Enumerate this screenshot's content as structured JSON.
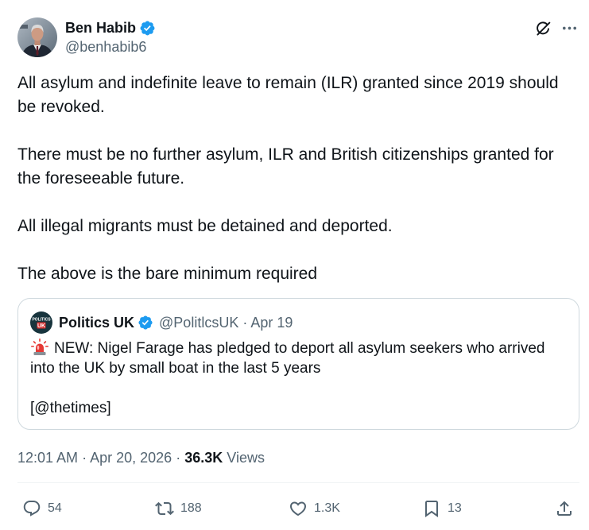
{
  "colors": {
    "text_primary": "#0f1419",
    "text_secondary": "#536471",
    "verified_blue": "#1d9bf0",
    "border": "#cfd9de",
    "background": "#ffffff"
  },
  "header_icons": [
    "grok-icon",
    "more-icon"
  ],
  "tweet": {
    "author": {
      "name": "Ben Habib",
      "handle": "@benhabib6",
      "verified": true
    },
    "paragraphs": [
      {
        "lines": [
          "All asylum and indefinite leave to remain (ILR) granted since 2019 should",
          "be revoked."
        ]
      },
      {
        "lines": [
          "There must be no further asylum, ILR and British citizenships granted for",
          "the foreseeable future."
        ]
      },
      {
        "lines": [
          "All illegal migrants must be detained and deported."
        ]
      },
      {
        "lines": [
          "The above is the bare minimum required"
        ]
      }
    ],
    "quote": {
      "author": {
        "name": "Politics UK",
        "handle": "@PolitlcsUK",
        "verified": true,
        "logo_text_top": "POLITICS",
        "logo_text_bottom": "UK"
      },
      "separator": "·",
      "date": "Apr 19",
      "lead_icon": "rotating-light-icon",
      "lines": [
        "NEW: Nigel Farage has pledged to deport all asylum seekers who arrived",
        "into the UK by small boat in the last 5 years"
      ],
      "source": "[@thetimes]"
    },
    "meta": {
      "time": "12:01 AM",
      "separator": "·",
      "date": "Apr 20, 2026",
      "views_count": "36.3K",
      "views_label": "Views"
    },
    "actions": {
      "reply": {
        "icon": "reply-icon",
        "count": "54"
      },
      "retweet": {
        "icon": "retweet-icon",
        "count": "188"
      },
      "like": {
        "icon": "heart-icon",
        "count": "1.3K"
      },
      "bookmark": {
        "icon": "bookmark-icon",
        "count": "13"
      },
      "share": {
        "icon": "share-icon"
      }
    }
  }
}
